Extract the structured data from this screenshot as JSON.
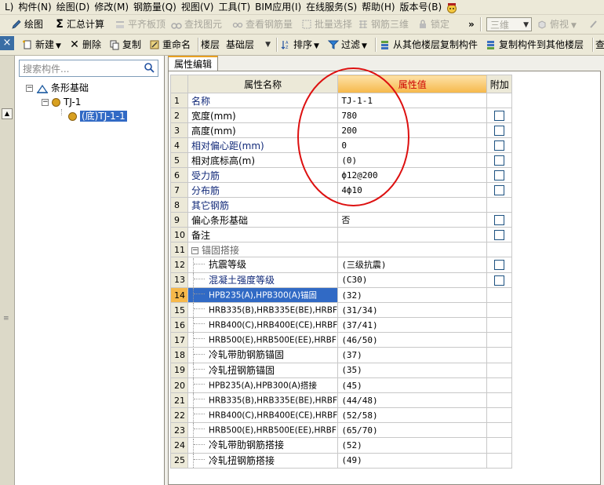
{
  "menu": [
    "L)",
    "构件(N)",
    "绘图(D)",
    "修改(M)",
    "钢筋量(Q)",
    "视图(V)",
    "工具(T)",
    "BIM应用(I)",
    "在线服务(S)",
    "帮助(H)",
    "版本号(B)"
  ],
  "toolbar1": {
    "draw": "绘图",
    "sum": "汇总计算",
    "align_top": "平齐板顶",
    "find": "查找图元",
    "view_rebar": "查看钢筋量",
    "batch_select": "批量选择",
    "rebar_3d": "钢筋三维",
    "lock": "锁定",
    "more": "»",
    "view_3d": "三维",
    "top_view": "俯视"
  },
  "toolbar2": {
    "new": "新建",
    "delete": "删除",
    "copy": "复制",
    "rename": "重命名",
    "floor_label": "楼层",
    "floor_value": "基础层",
    "sort": "排序",
    "filter": "过滤",
    "copy_from": "从其他楼层复制构件",
    "copy_to": "复制构件到其他楼层",
    "tail": "查"
  },
  "left": {
    "close": "×",
    "search_placeholder": "搜索构件...",
    "tree": {
      "root": "条形基础",
      "child": "TJ-1",
      "leaf": "(底)TJ-1-1"
    }
  },
  "panel": {
    "tab": "属性编辑",
    "headers": {
      "name": "属性名称",
      "value": "属性值",
      "add": "附加"
    },
    "rows": [
      {
        "n": "1",
        "name": "名称",
        "value": "TJ-1-1",
        "blue": true,
        "check": false
      },
      {
        "n": "2",
        "name": "宽度(mm)",
        "value": "780",
        "blue": false,
        "check": true
      },
      {
        "n": "3",
        "name": "高度(mm)",
        "value": "200",
        "blue": false,
        "check": true
      },
      {
        "n": "4",
        "name": "相对偏心距(mm)",
        "value": "0",
        "blue": true,
        "check": true
      },
      {
        "n": "5",
        "name": "相对底标高(m)",
        "value": "(0)",
        "blue": false,
        "check": true
      },
      {
        "n": "6",
        "name": "受力筋",
        "value": "ф12@200",
        "blue": true,
        "check": true
      },
      {
        "n": "7",
        "name": "分布筋",
        "value": "4ф10",
        "blue": true,
        "check": true
      },
      {
        "n": "8",
        "name": "其它钢筋",
        "value": "",
        "blue": true,
        "check": false
      },
      {
        "n": "9",
        "name": "偏心条形基础",
        "value": "否",
        "blue": false,
        "check": true
      },
      {
        "n": "10",
        "name": "备注",
        "value": "",
        "blue": false,
        "check": true
      },
      {
        "n": "11",
        "name": "锚固搭接",
        "value": "",
        "blue": false,
        "check": false
      },
      {
        "n": "12",
        "name": "抗震等级",
        "value": "(三级抗震)",
        "blue": false,
        "check": true
      },
      {
        "n": "13",
        "name": "混凝土强度等级",
        "value": "(C30)",
        "blue": true,
        "check": true
      },
      {
        "n": "14",
        "name": "HPB235(A),HPB300(A)锚固",
        "value": "(32)",
        "blue": false,
        "check": false
      },
      {
        "n": "15",
        "name": "HRB335(B),HRB335E(BE),HRBF",
        "value": "(31/34)",
        "blue": false,
        "check": false
      },
      {
        "n": "16",
        "name": "HRB400(C),HRB400E(CE),HRBF",
        "value": "(37/41)",
        "blue": false,
        "check": false
      },
      {
        "n": "17",
        "name": "HRB500(E),HRB500E(EE),HRBF",
        "value": "(46/50)",
        "blue": false,
        "check": false
      },
      {
        "n": "18",
        "name": "冷轧带肋钢筋锚固",
        "value": "(37)",
        "blue": false,
        "check": false
      },
      {
        "n": "19",
        "name": "冷轧扭钢筋锚固",
        "value": "(35)",
        "blue": false,
        "check": false
      },
      {
        "n": "20",
        "name": "HPB235(A),HPB300(A)搭接",
        "value": "(45)",
        "blue": false,
        "check": false
      },
      {
        "n": "21",
        "name": "HRB335(B),HRB335E(BE),HRBF",
        "value": "(44/48)",
        "blue": false,
        "check": false
      },
      {
        "n": "22",
        "name": "HRB400(C),HRB400E(CE),HRBF",
        "value": "(52/58)",
        "blue": false,
        "check": false
      },
      {
        "n": "23",
        "name": "HRB500(E),HRB500E(EE),HRBF",
        "value": "(65/70)",
        "blue": false,
        "check": false
      },
      {
        "n": "24",
        "name": "冷轧带肋钢筋搭接",
        "value": "(52)",
        "blue": false,
        "check": false
      },
      {
        "n": "25",
        "name": "冷轧扭钢筋搭接",
        "value": "(49)",
        "blue": false,
        "check": false
      }
    ],
    "selected_row": "14",
    "group_row": "11",
    "collapse_glyph": "−"
  },
  "colors": {
    "accent": "#f6b84a",
    "selection": "#316ac5",
    "annotation": "#dd1010",
    "link_blue": "#102878"
  }
}
